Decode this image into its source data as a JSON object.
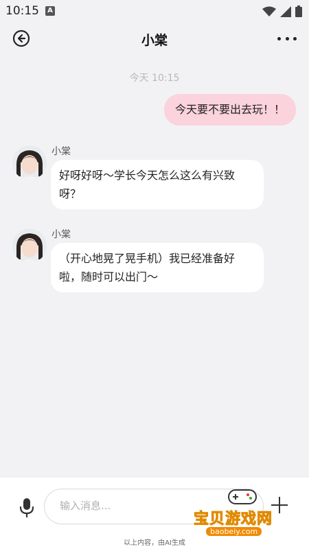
{
  "status_bar": {
    "time": "10:15",
    "notif_letter": "A"
  },
  "header": {
    "title": "小棠"
  },
  "chat": {
    "timestamp": "今天 10:15",
    "messages": [
      {
        "from": "me",
        "text": "今天要不要出去玩！！"
      },
      {
        "from": "other",
        "sender": "小棠",
        "text": "好呀好呀～学长今天怎么这么有兴致呀？"
      },
      {
        "from": "other",
        "sender": "小棠",
        "text": "（开心地晃了晃手机）我已经准备好啦，随时可以出门～"
      }
    ]
  },
  "input_bar": {
    "placeholder": "输入消息...",
    "value": ""
  },
  "footer": {
    "ai_note": "以上内容，由AI生成"
  },
  "watermark": {
    "title": "宝贝游戏网",
    "url": "baobeiy.com"
  },
  "colors": {
    "my_bubble": "#fbd3dc",
    "other_bubble": "#ffffff",
    "background": "#f2f2f4"
  }
}
